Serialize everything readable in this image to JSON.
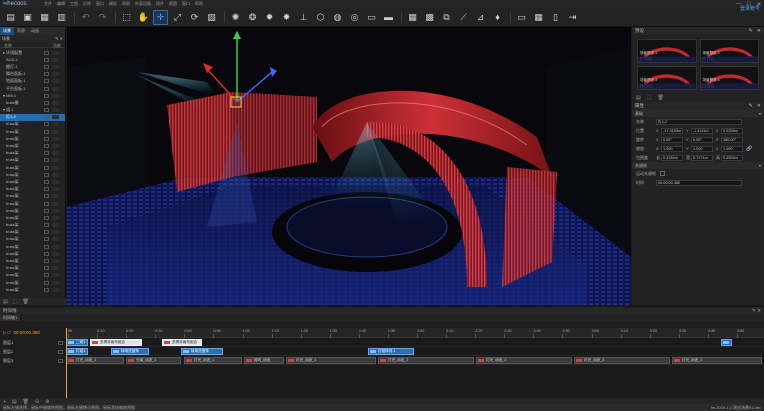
{
  "app": {
    "logo_mark": "∞",
    "name": "hecoos",
    "menus": [
      "文件",
      "编辑",
      "工程",
      "灯库",
      "窗口",
      "模拟",
      "帮助",
      "外部设备",
      "插件",
      "视图",
      "窗口",
      "帮助"
    ],
    "window_controls": [
      "—",
      "□",
      "✕"
    ],
    "user_button": "登录账号"
  },
  "toolbar": {
    "buttons": [
      {
        "name": "new-project",
        "glyph": "▤"
      },
      {
        "name": "open-project",
        "glyph": "▣"
      },
      {
        "name": "save-project",
        "glyph": "▦"
      },
      {
        "name": "export",
        "glyph": "▥"
      },
      {
        "name": "undo",
        "glyph": "↶"
      },
      {
        "name": "redo",
        "glyph": "↷"
      },
      {
        "name": "select",
        "glyph": "⬚"
      },
      {
        "name": "pan",
        "glyph": "✋"
      },
      {
        "name": "move",
        "glyph": "✛"
      },
      {
        "name": "scale",
        "glyph": "⤢"
      },
      {
        "name": "rotate",
        "glyph": "⟳"
      },
      {
        "name": "snap",
        "glyph": "▨"
      },
      {
        "name": "light-spot",
        "glyph": "✺"
      },
      {
        "name": "light-wash",
        "glyph": "❂"
      },
      {
        "name": "light-beam",
        "glyph": "✹"
      },
      {
        "name": "light-laser",
        "glyph": "✸"
      },
      {
        "name": "light-stage",
        "glyph": "⊥"
      },
      {
        "name": "cube",
        "glyph": "⬡"
      },
      {
        "name": "sphere",
        "glyph": "◍"
      },
      {
        "name": "camera",
        "glyph": "◎"
      },
      {
        "name": "screen",
        "glyph": "▭"
      },
      {
        "name": "video-screen",
        "glyph": "▬"
      },
      {
        "name": "grid-floor",
        "glyph": "▦"
      },
      {
        "name": "led-panel",
        "glyph": "▩"
      },
      {
        "name": "truss",
        "glyph": "⧉"
      },
      {
        "name": "ruler",
        "glyph": "⟋"
      },
      {
        "name": "measure",
        "glyph": "⊿"
      },
      {
        "name": "bell",
        "glyph": "♦"
      },
      {
        "name": "hide",
        "glyph": "▭"
      },
      {
        "name": "layout",
        "glyph": "▦"
      },
      {
        "name": "display",
        "glyph": "▯"
      },
      {
        "name": "exit",
        "glyph": "⇥"
      }
    ]
  },
  "left_panel": {
    "tabs": [
      "场景",
      "资源",
      "动画"
    ],
    "title": "场景",
    "col_name": "名称",
    "col_func": "功能",
    "tree": [
      {
        "label": "▸ 环境配置",
        "depth": 1,
        "selected": false
      },
      {
        "label": "ACD-1",
        "depth": 2,
        "selected": false
      },
      {
        "label": "摄灯-1",
        "depth": 2,
        "selected": false
      },
      {
        "label": "舞台面板-1",
        "depth": 2,
        "selected": false
      },
      {
        "label": "地面面板-1",
        "depth": 2,
        "selected": false
      },
      {
        "label": "平台面板-1",
        "depth": 2,
        "selected": false
      },
      {
        "label": "▾ Mi9-1",
        "depth": 1,
        "selected": false
      },
      {
        "label": "truss摄",
        "depth": 2,
        "selected": false
      },
      {
        "label": "▾ 组-1",
        "depth": 1,
        "selected": false
      },
      {
        "label": "灯1-2",
        "depth": 2,
        "selected": true
      },
      {
        "label": "truss架",
        "depth": 2,
        "selected": false
      },
      {
        "label": "truss架",
        "depth": 2,
        "selected": false
      },
      {
        "label": "truss架",
        "depth": 2,
        "selected": false
      },
      {
        "label": "truss架",
        "depth": 2,
        "selected": false
      },
      {
        "label": "truss架",
        "depth": 2,
        "selected": false
      },
      {
        "label": "truss架",
        "depth": 2,
        "selected": false
      },
      {
        "label": "truss架",
        "depth": 2,
        "selected": false
      },
      {
        "label": "truss架",
        "depth": 2,
        "selected": false
      },
      {
        "label": "truss架",
        "depth": 2,
        "selected": false
      },
      {
        "label": "truss架",
        "depth": 2,
        "selected": false
      },
      {
        "label": "truss架",
        "depth": 2,
        "selected": false
      },
      {
        "label": "truss架",
        "depth": 2,
        "selected": false
      },
      {
        "label": "truss架",
        "depth": 2,
        "selected": false
      },
      {
        "label": "truss架",
        "depth": 2,
        "selected": false
      },
      {
        "label": "truss架",
        "depth": 2,
        "selected": false
      },
      {
        "label": "truss架",
        "depth": 2,
        "selected": false
      },
      {
        "label": "truss架",
        "depth": 2,
        "selected": false
      },
      {
        "label": "truss架",
        "depth": 2,
        "selected": false
      },
      {
        "label": "truss架",
        "depth": 2,
        "selected": false
      },
      {
        "label": "truss架",
        "depth": 2,
        "selected": false
      },
      {
        "label": "truss架",
        "depth": 2,
        "selected": false
      },
      {
        "label": "truss架",
        "depth": 2,
        "selected": false
      },
      {
        "label": "truss架",
        "depth": 2,
        "selected": false
      },
      {
        "label": "truss架",
        "depth": 2,
        "selected": false
      }
    ],
    "footer_icons": [
      "▤",
      "⬚",
      "🗑"
    ]
  },
  "right_panel": {
    "presets_title": "预设",
    "thumbs": [
      {
        "caption": "场景预设-1"
      },
      {
        "caption": "场景预设-2"
      },
      {
        "caption": "场景预设-3"
      },
      {
        "caption": "场景预设-4"
      }
    ],
    "props_title": "属性",
    "group_basic": "基础",
    "name_label": "名称",
    "name_value": "灯1-2",
    "pos_label": "位置",
    "pos": [
      "-17.3153m",
      "-1.4111m",
      "0.0293m"
    ],
    "rot_label": "旋转",
    "rot": [
      "0.00°",
      "0.00°",
      "180.00°"
    ],
    "scale_label": "缩放",
    "scale": [
      "1.000",
      "1.000",
      "1.000"
    ],
    "bbox_label": "包围盒",
    "bbox": [
      "0.4784m",
      "0.7271m",
      "0.2553m"
    ],
    "group_anim": "关键帧",
    "anim_label": "运动关键帧",
    "time_label": "时间",
    "time_value": "00:00:00.360"
  },
  "timeline": {
    "title": "时间线",
    "tab": "时间轴1",
    "timecode": "00:00:00.360",
    "ticks": [
      "00",
      "0:10",
      "0:20",
      "0:30",
      "0:40",
      "0:50",
      "1:00",
      "1:10",
      "1:20",
      "1:30",
      "1:40",
      "1:50",
      "2:00",
      "2:10",
      "2:20",
      "2:30",
      "2:40",
      "2:50",
      "3:00",
      "3:10",
      "3:20",
      "3:30",
      "3:40",
      "3:50"
    ],
    "rows": [
      {
        "label": "图层1"
      },
      {
        "label": "图层2"
      },
      {
        "label": "图层3"
      }
    ],
    "clips": {
      "row1": [
        {
          "text": "二维1.",
          "start": 0,
          "width": 22,
          "style": ""
        },
        {
          "text": "多屏双画布组合",
          "start": 24,
          "width": 52,
          "style": "pale"
        },
        {
          "text": "多屏双画布组合",
          "start": 96,
          "width": 40,
          "style": "pale"
        },
        {
          "text": "",
          "start": 655,
          "width": 8,
          "style": ""
        }
      ],
      "row2": [
        {
          "text": "灯组1.",
          "start": 0,
          "width": 22,
          "style": ""
        },
        {
          "text": "转场进度条",
          "start": 45,
          "width": 38,
          "style": ""
        },
        {
          "text": "转场进度条",
          "start": 115,
          "width": 42,
          "style": ""
        },
        {
          "text": "灯组特效-1",
          "start": 302,
          "width": 46,
          "style": ""
        }
      ],
      "row3": [
        {
          "text": "灯光_动态_1",
          "start": 0,
          "width": 58,
          "style": "fx"
        },
        {
          "text": "光束_动态_1",
          "start": 60,
          "width": 55,
          "style": "fx"
        },
        {
          "text": "灯光_动态_1",
          "start": 118,
          "width": 58,
          "style": "fx"
        },
        {
          "text": "频闪_动态",
          "start": 178,
          "width": 40,
          "style": "fx"
        },
        {
          "text": "灯光_动态_1",
          "start": 220,
          "width": 90,
          "style": "fx"
        },
        {
          "text": "灯光_动态_2",
          "start": 312,
          "width": 96,
          "style": "fx"
        },
        {
          "text": "灯光_动态_2",
          "start": 410,
          "width": 96,
          "style": "fx"
        },
        {
          "text": "灯光_动态_3",
          "start": 508,
          "width": 96,
          "style": "fx"
        },
        {
          "text": "灯光_动态_3",
          "start": 606,
          "width": 90,
          "style": "fx"
        }
      ]
    },
    "footer_icons": [
      "+",
      "▤",
      "🗑",
      "⊖",
      "⊕"
    ]
  },
  "status": {
    "left": "鼠标左键选择，鼠标中键旋转视图，鼠标右键移动视图，鼠标滚轮缩放视图",
    "right": "fm.2019.1.2 演出场景01.hec"
  }
}
